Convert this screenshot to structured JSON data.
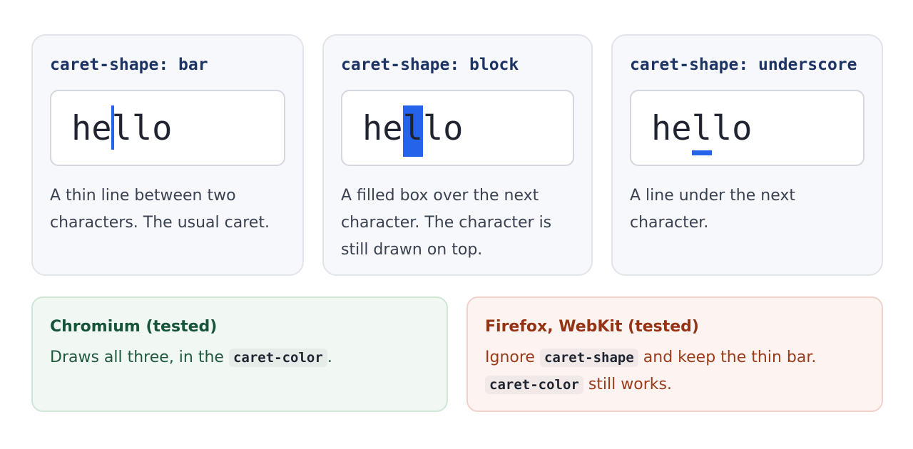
{
  "cards": [
    {
      "title": "caret-shape: bar",
      "demo": {
        "before": "he",
        "at": "l",
        "after": "lo"
      },
      "description": "A thin line between two characters. The usual caret."
    },
    {
      "title": "caret-shape: block",
      "demo": {
        "before": "he",
        "at": "l",
        "after": "lo"
      },
      "description": "A filled box over the next character. The character is still drawn on top."
    },
    {
      "title": "caret-shape: underscore",
      "demo": {
        "before": "he",
        "at": "l",
        "after": "lo"
      },
      "description": "A line under the next character."
    }
  ],
  "notes": {
    "chromium": {
      "title": "Chromium (tested)",
      "text_before": "Draws all three, in the",
      "code": "caret-color",
      "text_after": "."
    },
    "others": {
      "title": "Firefox, WebKit (tested)",
      "text_before": "Ignore",
      "code1": "caret-shape",
      "text_middle": "and keep the thin bar.",
      "code2": "caret-color",
      "text_after": "still works."
    }
  },
  "colors": {
    "caret": "#2563eb",
    "title": "#1d3364",
    "ok_title": "#17543a",
    "no_title": "#943414"
  }
}
